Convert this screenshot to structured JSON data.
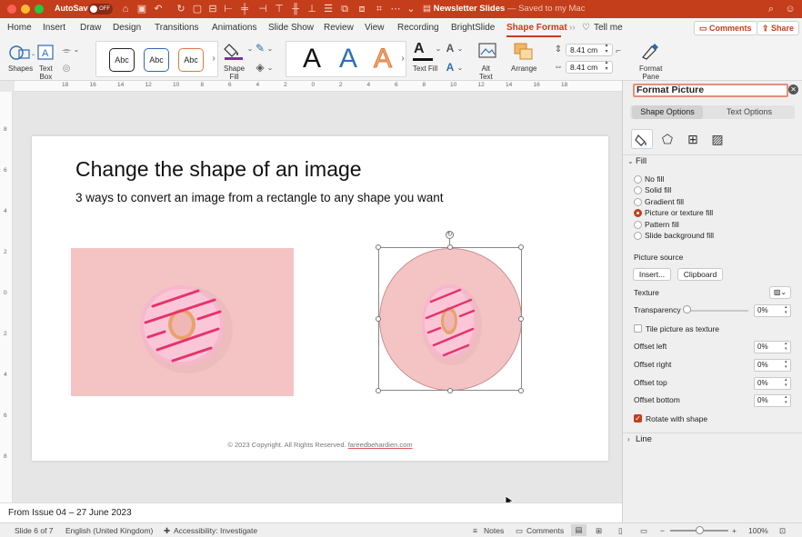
{
  "colors": {
    "accent": "#c43e1c",
    "title_bar": "#c43e1c",
    "fill_line": "#7b2fa5"
  },
  "titlebar": {
    "autosave_label": "AutoSave",
    "autosave_state": "OFF",
    "doc_name": "Newsletter Slides",
    "doc_status": "— Saved to my Mac"
  },
  "tabs": [
    "Home",
    "Insert",
    "Draw",
    "Design",
    "Transitions",
    "Animations",
    "Slide Show",
    "Review",
    "View",
    "Recording",
    "BrightSlide",
    "Shape Format"
  ],
  "active_tab": "Shape Format",
  "tell_me": "Tell me",
  "comments_label": "Comments",
  "share_label": "Share",
  "ribbon": {
    "shapes": "Shapes",
    "text_box": "Text\nBox",
    "abc": [
      "Abc",
      "Abc",
      "Abc"
    ],
    "shape_fill": "Shape\nFill",
    "text_fill": "Text Fill",
    "alt_text": "Alt\nText",
    "arrange": "Arrange",
    "height": "8.41 cm",
    "width": "8.41 cm",
    "format_pane": "Format\nPane",
    "big_letter": "A"
  },
  "ruler": {
    "h": [
      "18",
      "16",
      "14",
      "12",
      "10",
      "8",
      "6",
      "4",
      "2",
      "0",
      "2",
      "4",
      "6",
      "8",
      "10",
      "12",
      "14",
      "16",
      "18"
    ],
    "v": [
      "8",
      "6",
      "4",
      "2",
      "0",
      "2",
      "4",
      "6",
      "8"
    ]
  },
  "slide": {
    "title": "Change the shape of an image",
    "subtitle": "3 ways to convert an image from a rectangle to any shape you want",
    "footer_text": "© 2023 Copyright. All Rights Reserved.",
    "footer_link": "fareedbehardien.com"
  },
  "notes": "From Issue 04 – 27 June 2023",
  "status": {
    "slide": "Slide 6 of 7",
    "language": "English (United Kingdom)",
    "accessibility": "Accessibility: Investigate",
    "notes": "Notes",
    "comments": "Comments",
    "zoom": "100%"
  },
  "pane": {
    "title": "Format Picture",
    "tab_shape": "Shape Options",
    "tab_text": "Text Options",
    "fill_header": "Fill",
    "fill_options": [
      "No fill",
      "Solid fill",
      "Gradient fill",
      "Picture or texture fill",
      "Pattern fill",
      "Slide background fill"
    ],
    "fill_selected": "Picture or texture fill",
    "picture_source": "Picture source",
    "insert_btn": "Insert...",
    "clipboard_btn": "Clipboard",
    "texture": "Texture",
    "transparency": "Transparency",
    "transparency_value": "0%",
    "tile": "Tile picture as texture",
    "tile_checked": false,
    "offsets": [
      {
        "label": "Offset left",
        "value": "0%"
      },
      {
        "label": "Offset right",
        "value": "0%"
      },
      {
        "label": "Offset top",
        "value": "0%"
      },
      {
        "label": "Offset bottom",
        "value": "0%"
      }
    ],
    "rotate": "Rotate with shape",
    "rotate_checked": true,
    "line_header": "Line"
  }
}
